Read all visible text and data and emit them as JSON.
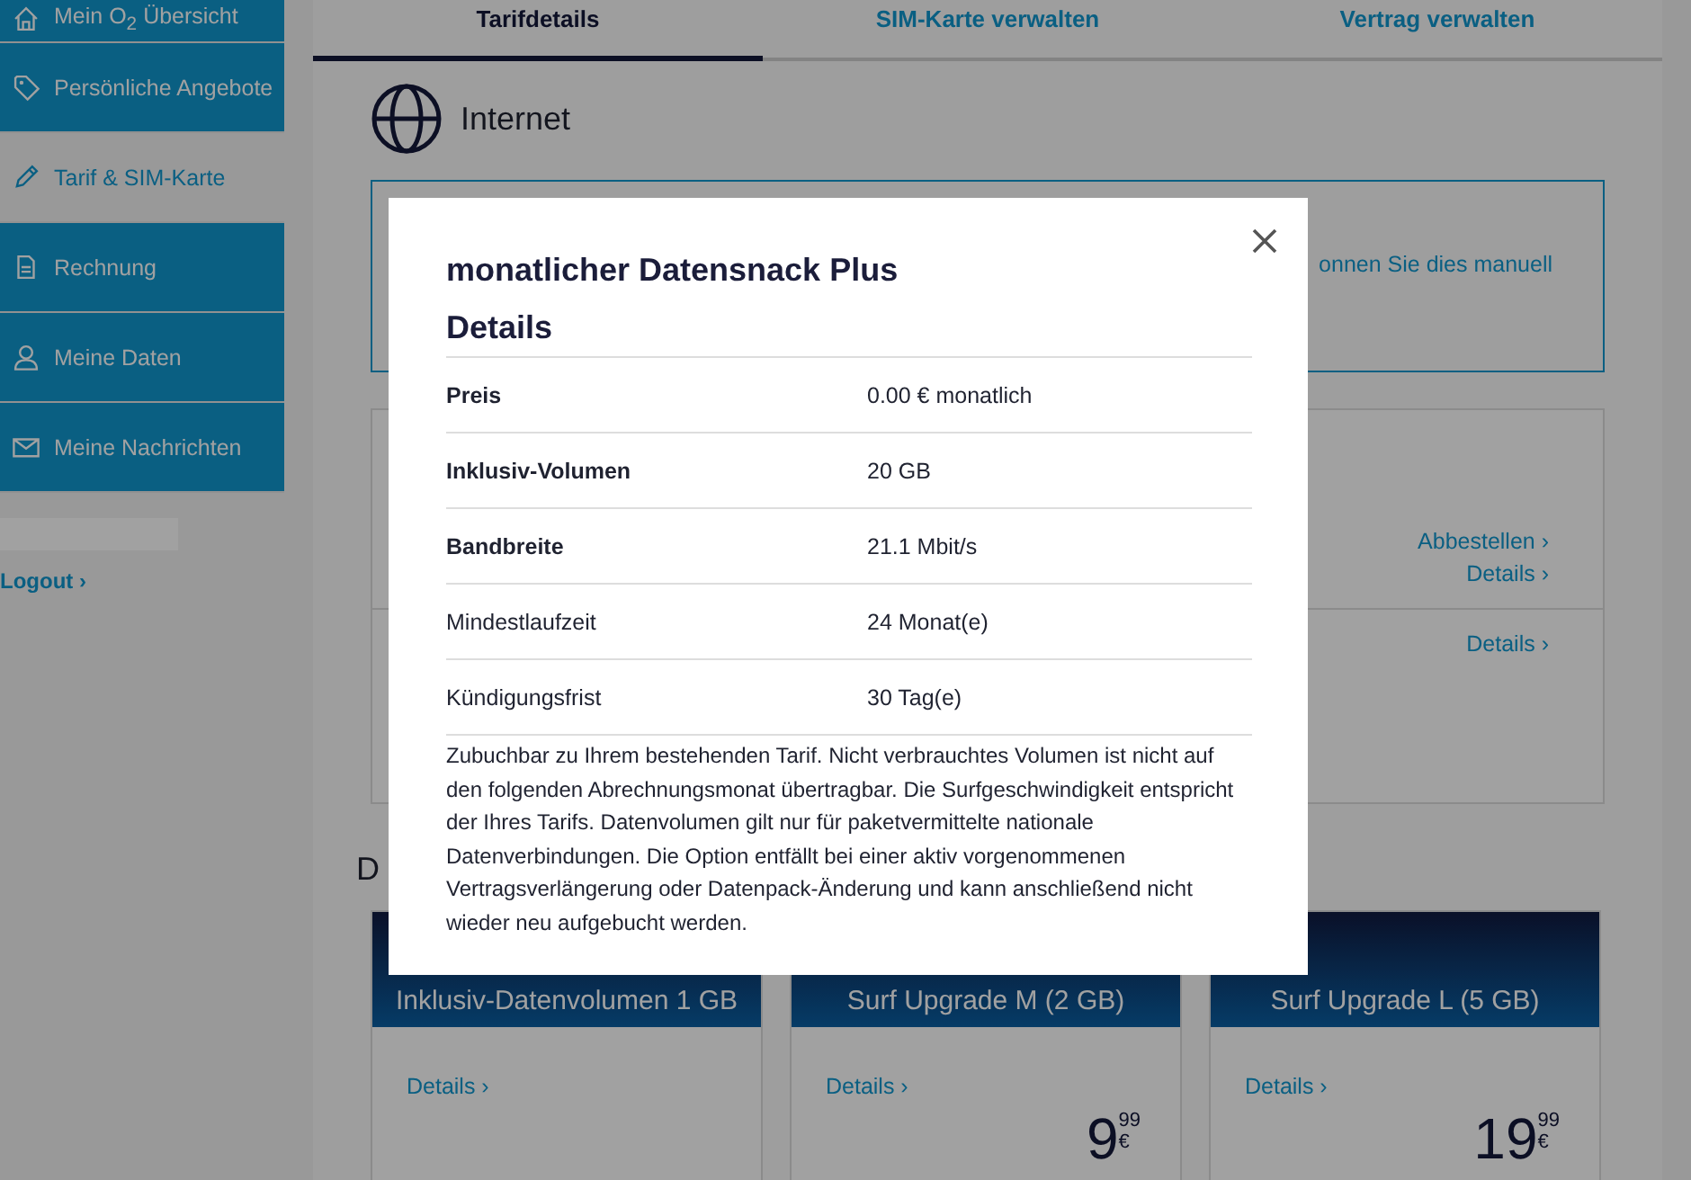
{
  "sidebar": {
    "items": [
      {
        "label": "Mein O$_{2}$ Übersicht",
        "selected": false
      },
      {
        "label": "Persönliche Angebote",
        "selected": false
      },
      {
        "label": "Tarif & SIM-Karte",
        "selected": true
      },
      {
        "label": "Rechnung",
        "selected": false
      },
      {
        "label": "Meine Daten",
        "selected": false
      },
      {
        "label": "Meine Nachrichten",
        "selected": false
      }
    ],
    "logout": "Logout ›"
  },
  "tabs": [
    {
      "label": "Tarifdetails",
      "selected": true
    },
    {
      "label": "SIM-Karte verwalten",
      "selected": false
    },
    {
      "label": "Vertrag verwalten",
      "selected": false
    }
  ],
  "section": {
    "title": "Internet",
    "notice": "onnen Sie dies manuell",
    "links": [
      "Abbestellen ›",
      "Details ›",
      "Details ›"
    ],
    "heading": "D"
  },
  "packs": [
    {
      "title": "Inklusiv-Datenvolumen 1 GB",
      "link": "Details ›"
    },
    {
      "title": "Surf Upgrade M (2 GB)",
      "link": "Details ›",
      "price": "9",
      "cents": "99",
      "currency": "€"
    },
    {
      "title": "Surf Upgrade L (5 GB)",
      "link": "Details ›",
      "price": "19",
      "cents": "99",
      "currency": "€"
    }
  ],
  "modal": {
    "title": "monatlicher Datensnack Plus",
    "subtitle": "Details",
    "rows": [
      {
        "label": "Preis",
        "value": "0.00 € monatlich",
        "emphasized": true
      },
      {
        "label": "Inklusiv-Volumen",
        "value": "20 GB",
        "emphasized": true
      },
      {
        "label": "Bandbreite",
        "value": "21.1 Mbit/s",
        "emphasized": true
      },
      {
        "label": "Mindestlaufzeit",
        "value": "24 Monat(e)",
        "emphasized": false
      },
      {
        "label": "Kündigungsfrist",
        "value": "30 Tag(e)",
        "emphasized": false
      }
    ],
    "description": "Zubuchbar zu Ihrem bestehenden Tarif. Nicht verbrauchtes Volumen ist nicht auf den folgenden Abrechnungsmonat übertragbar. Die Surfgeschwindigkeit entspricht der Ihres Tarifs. Datenvolumen gilt nur für paketvermittelte nationale Datenverbindungen. Die Option entfällt bei einer aktiv vorgenommenen Vertragsverlängerung oder Datenpack-Änderung und kann anschließend nicht wieder neu aufgebucht werden."
  }
}
